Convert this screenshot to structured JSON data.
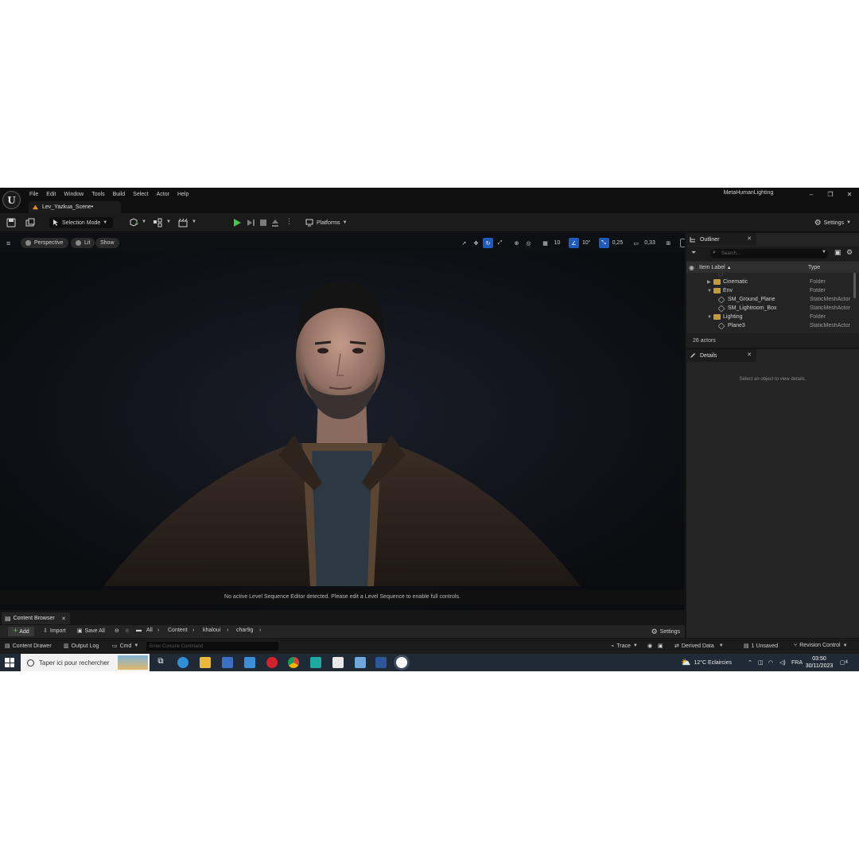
{
  "menu": {
    "items": [
      "File",
      "Edit",
      "Window",
      "Tools",
      "Build",
      "Select",
      "Actor",
      "Help"
    ],
    "project_name": "MetaHumanLighting",
    "level_tab": "Lev_Yazkua_Scene•"
  },
  "toolbar": {
    "selection_mode": "Selection Mode",
    "platforms": "Platforms",
    "settings": "Settings"
  },
  "viewport": {
    "perspective": "Perspective",
    "lit": "Lit",
    "show": "Show",
    "grid_snap": "10",
    "rot_snap": "10°",
    "scale_snap": "0,25",
    "camera_speed": "0,33",
    "sequence_message": "No active Level Sequence Editor detected. Please edit a Level Sequence to enable full controls."
  },
  "outliner": {
    "title": "Outliner",
    "search_placeholder": "Search...",
    "col_label": "Item Label",
    "col_type": "Type",
    "rows": [
      {
        "label": "Cinematic",
        "type": "Folder",
        "kind": "folder",
        "depth": 1,
        "expanded": false
      },
      {
        "label": "Env",
        "type": "Folder",
        "kind": "folder",
        "depth": 1,
        "expanded": true
      },
      {
        "label": "SM_Ground_Plane",
        "type": "StaticMeshActor",
        "kind": "mesh",
        "depth": 2
      },
      {
        "label": "SM_Lightroom_Box",
        "type": "StaticMeshActor",
        "kind": "mesh",
        "depth": 2
      },
      {
        "label": "Lighting",
        "type": "Folder",
        "kind": "folder",
        "depth": 1,
        "expanded": true
      },
      {
        "label": "Plane3",
        "type": "StaticMeshActor",
        "kind": "mesh",
        "depth": 2
      }
    ],
    "actor_count": "26 actors"
  },
  "details": {
    "title": "Details",
    "empty_message": "Select an object to view details."
  },
  "content_browser": {
    "tab": "Content Browser",
    "add": "Add",
    "import": "Import",
    "save_all": "Save All",
    "path": [
      "All",
      "Content",
      "khaloui",
      "char9g"
    ],
    "settings": "Settings"
  },
  "statusbar": {
    "content_drawer": "Content Drawer",
    "output_log": "Output Log",
    "cmd": "Cmd",
    "console_placeholder": "Enter Console Command",
    "trace": "Trace",
    "derived_data": "Derived Data",
    "unsaved": "1 Unsaved",
    "revision_control": "Revision Control"
  },
  "taskbar": {
    "search_placeholder": "Taper ici pour rechercher",
    "weather": "12°C  Eclaircies",
    "language": "FRA",
    "time": "03:50",
    "date": "30/11/2023",
    "notifications": "4"
  },
  "colors": {
    "accent_blue": "#1e5bbd",
    "play_green": "#4fc04f",
    "folder_yellow": "#c39a3e"
  }
}
